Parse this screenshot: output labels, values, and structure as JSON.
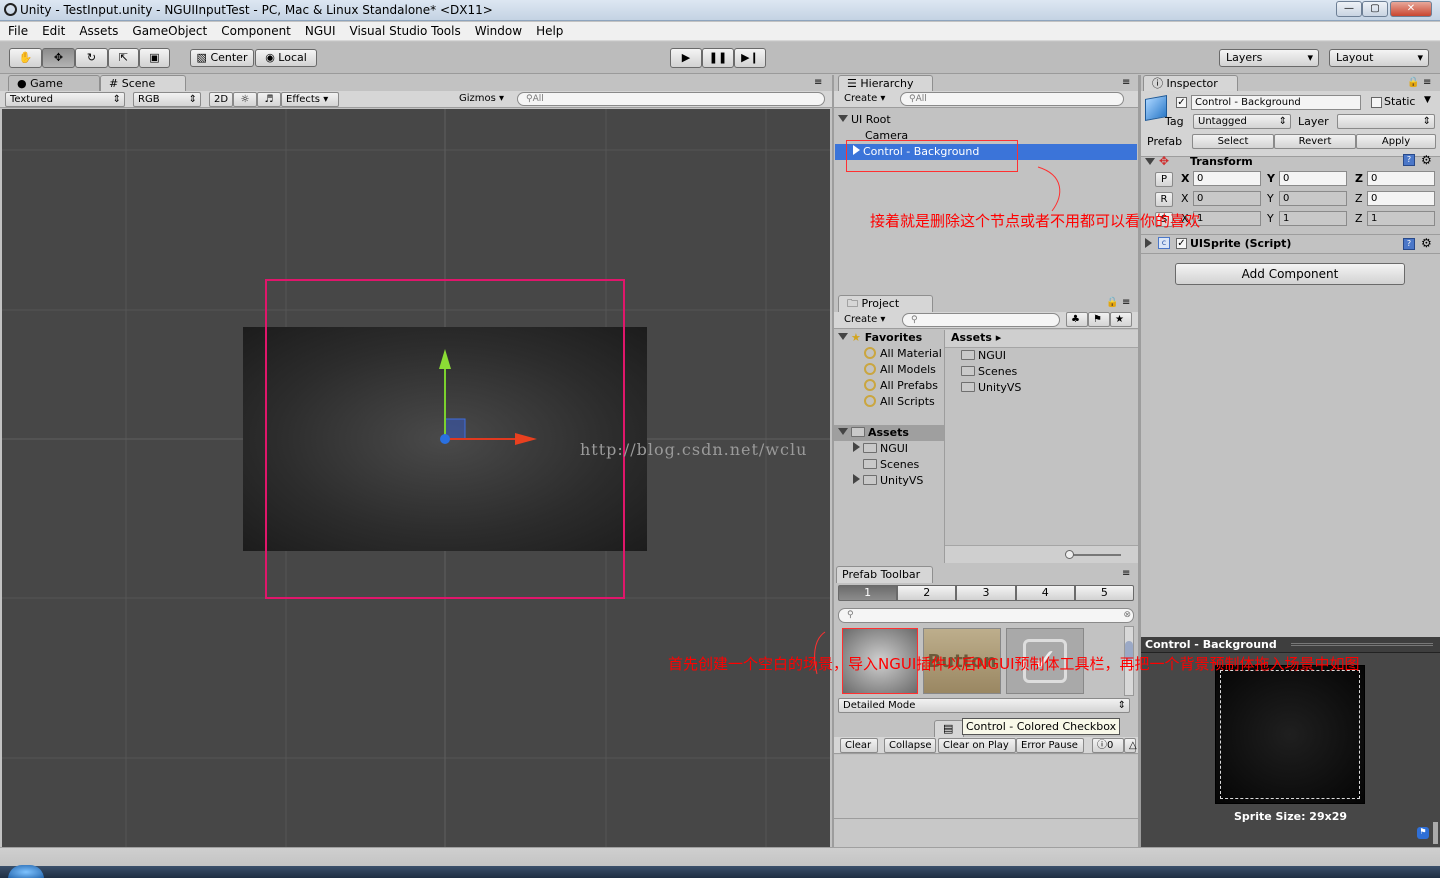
{
  "window": {
    "title": "Unity - TestInput.unity - NGUIInputTest - PC, Mac & Linux Standalone* <DX11>"
  },
  "menu": [
    "File",
    "Edit",
    "Assets",
    "GameObject",
    "Component",
    "NGUI",
    "Visual Studio Tools",
    "Window",
    "Help"
  ],
  "toolbar": {
    "center": "Center",
    "local": "Local",
    "layers": "Layers",
    "layout": "Layout"
  },
  "scene": {
    "tabs": {
      "game": "Game",
      "scene": "Scene"
    },
    "shading": "Textured",
    "render": "RGB",
    "mode2d": "2D",
    "effects": "Effects",
    "gizmos": "Gizmos",
    "search": "All",
    "watermark": "http://blog.csdn.net/wclu"
  },
  "hierarchy": {
    "tab": "Hierarchy",
    "create": "Create",
    "search": "All",
    "items": [
      "UI Root",
      "Camera",
      "Control - Background"
    ]
  },
  "project": {
    "tab": "Project",
    "create": "Create",
    "favorites_label": "Favorites",
    "favorites": [
      "All Material",
      "All Models",
      "All Prefabs",
      "All Scripts"
    ],
    "assets_label": "Assets",
    "tree": [
      "NGUI",
      "Scenes",
      "UnityVS"
    ],
    "breadcrumb": "Assets",
    "files": [
      "NGUI",
      "Scenes",
      "UnityVS"
    ]
  },
  "prefab_toolbar": {
    "tab": "Prefab Toolbar",
    "pages": [
      "1",
      "2",
      "3",
      "4",
      "5"
    ],
    "button_text": "Button",
    "mode": "Detailed Mode",
    "tooltip": "Control - Colored Checkbox"
  },
  "console": {
    "clear": "Clear",
    "collapse": "Collapse",
    "clear_on_play": "Clear on Play",
    "error_pause": "Error Pause",
    "count": "0"
  },
  "inspector": {
    "tab": "Inspector",
    "name": "Control - Background",
    "static": "Static",
    "tag_label": "Tag",
    "tag": "Untagged",
    "layer_label": "Layer",
    "prefab_label": "Prefab",
    "select": "Select",
    "revert": "Revert",
    "apply": "Apply",
    "transform": "Transform",
    "p": "P",
    "r": "R",
    "s": "S",
    "x": "X",
    "y": "Y",
    "z": "Z",
    "pos": [
      "0",
      "0",
      "0"
    ],
    "rot": [
      "0",
      "0",
      "0"
    ],
    "scale": [
      "1",
      "1",
      "1"
    ],
    "script": "UISprite (Script)",
    "add_component": "Add Component",
    "preview_title": "Control - Background",
    "sprite_size": "Sprite Size: 29x29"
  },
  "annotations": {
    "top": "接着就是删除这个节点或者不用都可以看你的喜欢",
    "bottom": "首先创建一个空白的场景，导入NGUI插件以后NGUI预制体工具栏，再把一个背景预制体拖入场景中如图"
  },
  "colors": {
    "selection": "#3b74d9",
    "annotation": "#ff0000",
    "highlight_rect": "#e0166b",
    "scene_bg": "#474747"
  }
}
